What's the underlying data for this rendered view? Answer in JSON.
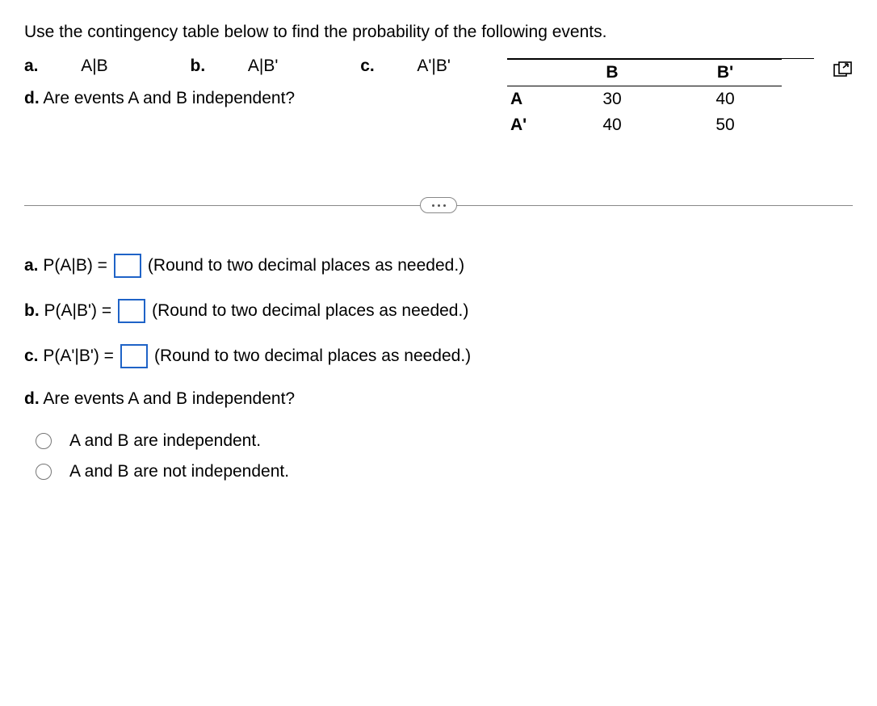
{
  "intro": "Use the contingency table below to find the probability of the following events.",
  "parts": {
    "a_label": "a.",
    "a_text": "A|B",
    "b_label": "b.",
    "b_text": "A|B'",
    "c_label": "c.",
    "c_text": "A'|B'",
    "d_label": "d.",
    "d_text": "Are events A and B independent?"
  },
  "table": {
    "col1": "B",
    "col2": "B'",
    "row1_header": "A",
    "row1_col1": "30",
    "row1_col2": "40",
    "row2_header": "A'",
    "row2_col1": "40",
    "row2_col2": "50"
  },
  "answers": {
    "a": {
      "prefix": "a.",
      "label": "P(A|B) =",
      "value": "",
      "hint": "(Round to two decimal places as needed.)"
    },
    "b": {
      "prefix": "b.",
      "label": "P(A|B') =",
      "value": "",
      "hint": "(Round to two decimal places as needed.)"
    },
    "c": {
      "prefix": "c.",
      "label": "P(A'|B') =",
      "value": "",
      "hint": "(Round to two decimal places as needed.)"
    },
    "d": {
      "prefix": "d.",
      "question": "Are events A and B independent?",
      "option1": "A and B are independent.",
      "option2": "A and B are not independent."
    }
  },
  "icons": {
    "popout": "popout-icon",
    "expand": "expand-pill"
  }
}
